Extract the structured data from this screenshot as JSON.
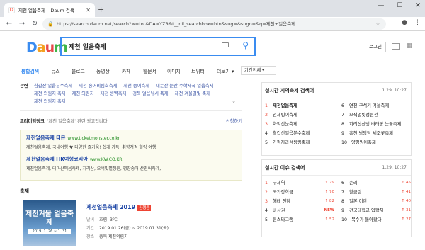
{
  "browser": {
    "tab_title": "제천 얼음축제 – Daum 검색",
    "url": "https://search.daum.net/search?w=tot&DA=YZR&t__nil_searchbox=btn&sug=&sugo=&q=제천+얼음축제"
  },
  "header": {
    "logo": "Daum",
    "query": "제천 얼음축제",
    "login": "로그인"
  },
  "tabs": [
    "통합검색",
    "뉴스",
    "블로그",
    "동영상",
    "카페",
    "웹문서",
    "이미지",
    "트위터",
    "더보기 ▾"
  ],
  "period": "기간전체 ▾",
  "related": {
    "label": "관련",
    "items": [
      "참갑산 얼음분수축제",
      "제천 송어비빔회축제",
      "제천 송어축제",
      "대둔산 눈산 수학제국 얼음축제",
      "제천 의림지 축제",
      "제천 의림지",
      "제천 빙벽축제",
      "경북 얼음낚시 축제",
      "제천 겨울별빛 축제",
      "제천 의림지 축제"
    ]
  },
  "powerlink": {
    "label": "프리미엄링크",
    "query": "'제천 얼음축제' 관련 광고입니다.",
    "apply": "신청하기",
    "ads": [
      {
        "title": "제천얼음축제 티몬",
        "domain": "www.ticketmonster.co.kr",
        "desc": "제천얼음축제, 국내여행 ♥ 다양한 즐거움! 쉽게 가득, 취향저격 힐링 여행!"
      },
      {
        "title": "제천얼음축제 HK여행코리아",
        "domain": "www.KW.CO.KR",
        "desc": "제천얼음축제, 테마산맥음축제, 지리산, 오색빛별정원, 평창송어 산천어축제,"
      }
    ]
  },
  "festival": {
    "section": "축제",
    "title": "제천얼음축제 2019",
    "badge": "진행중",
    "poster": "제천겨울 얼음축제",
    "poster_date": "2019. 1. 26 ~ 1. 31",
    "rows": [
      {
        "k": "날씨",
        "v": "흐림 -3℃"
      },
      {
        "k": "기간",
        "v": "2019.01.26(금) ~ 2019.01.31(목)"
      },
      {
        "k": "장소",
        "v": "충북 제천의림지"
      }
    ]
  },
  "region": {
    "title": "실시간 지역축제 검색어",
    "time": "1.29. 10:27",
    "left": [
      "제천얼음축제",
      "인제빙어축제",
      "화악산눈축제",
      "칠갑산얼음분수축제",
      "가평자라섬씽씽축제"
    ],
    "right": [
      "연천 구석기 겨울축제",
      "오색별빛정원전",
      "지리산산빙 바래봉 눈꽃축제",
      "홍천 낭당탐 세조꽃축제",
      "양평빙어축제"
    ]
  },
  "issue": {
    "title": "실시간 이슈 검색어",
    "time": "1.29. 10:27",
    "left": [
      {
        "t": "구제역",
        "c": "↑ 79"
      },
      {
        "t": "국가장학금",
        "c": "↑ 70"
      },
      {
        "t": "헤테 전혜",
        "c": "↑ 82"
      },
      {
        "t": "비상권",
        "c": "NEW"
      },
      {
        "t": "원스타그램",
        "c": "↑ 52"
      }
    ],
    "right": [
      {
        "t": "손리",
        "c": "↑ 45"
      },
      {
        "t": "할금란",
        "c": "↑ 41"
      },
      {
        "t": "일본 이란",
        "c": "↑ 40"
      },
      {
        "t": "건국대학교 입학처",
        "c": "↑ 31"
      },
      {
        "t": "복수가 돌아왔다",
        "c": "↑ 27"
      }
    ]
  }
}
